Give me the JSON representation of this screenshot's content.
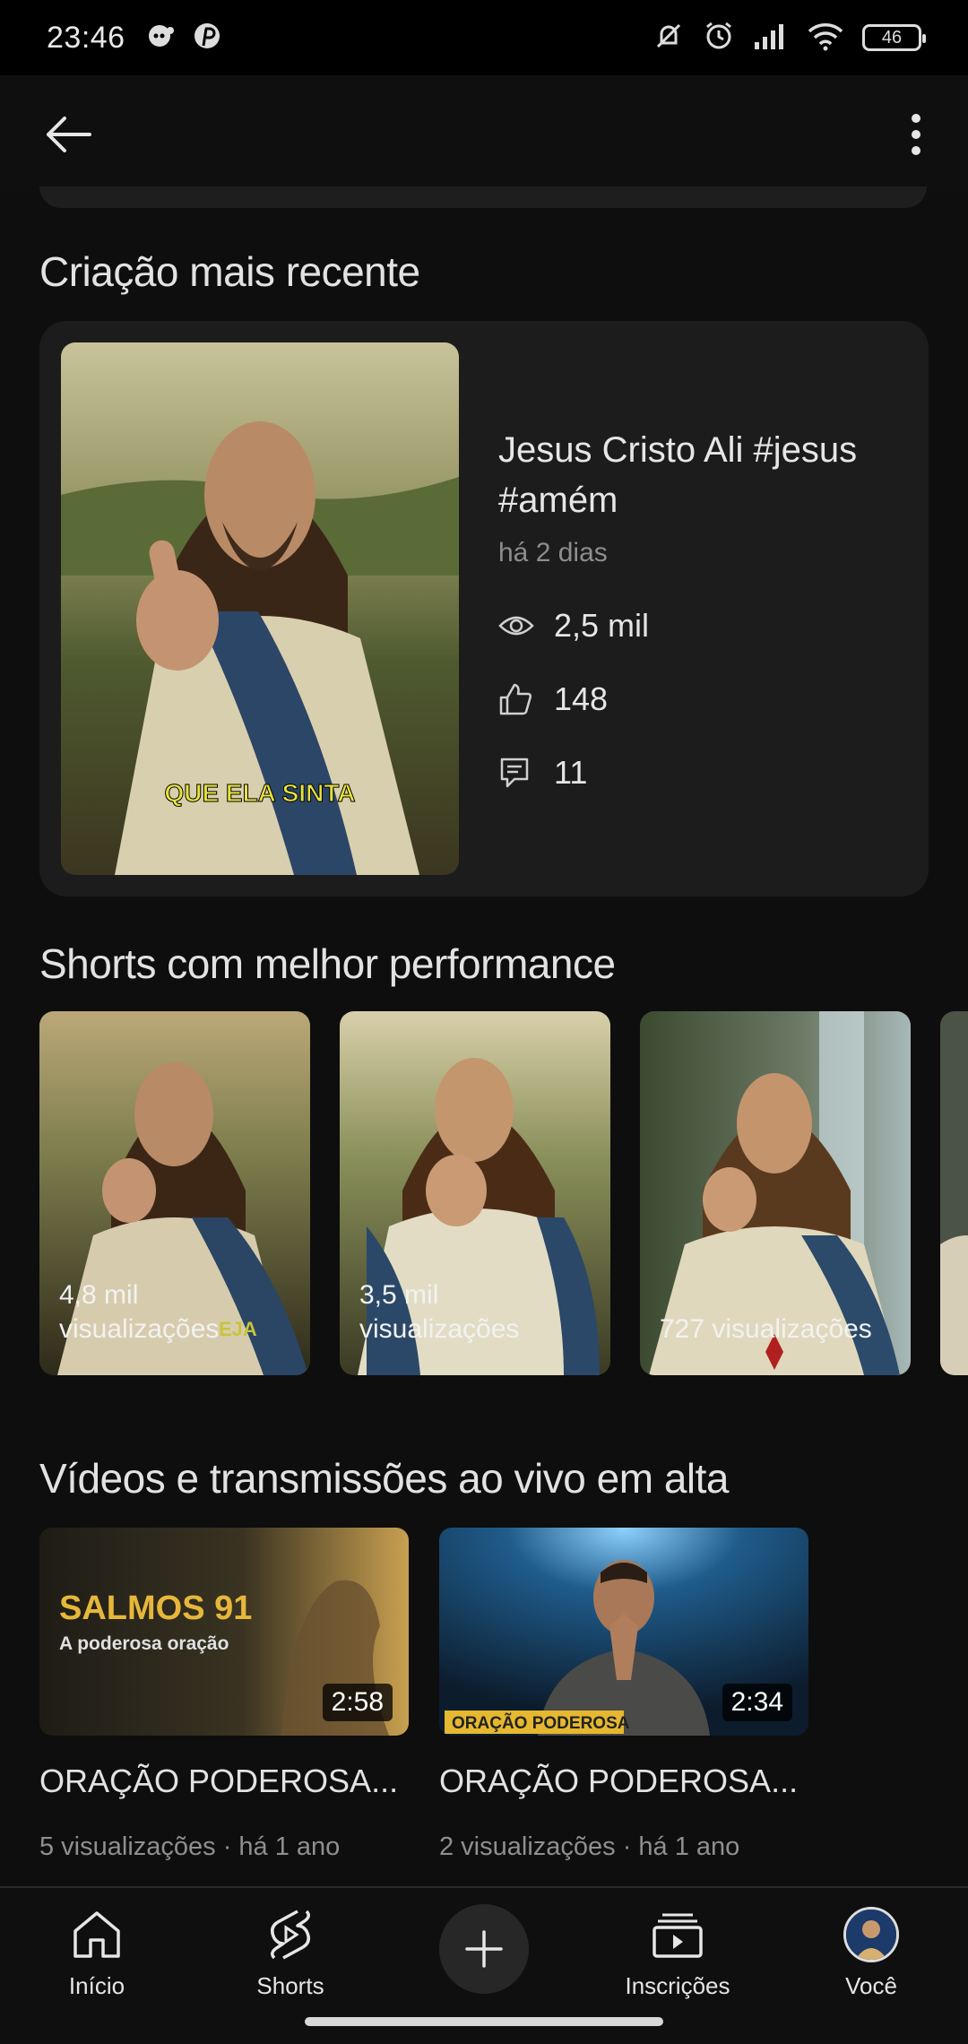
{
  "status_bar": {
    "time": "23:46",
    "battery": "46"
  },
  "recent": {
    "section_title": "Criação mais recente",
    "video_title": "Jesus Cristo Ali #jesus #amém",
    "date": "há 2 dias",
    "views": "2,5 mil",
    "likes": "148",
    "comments": "11",
    "thumb_caption": "QUE ELA SINTA"
  },
  "shorts": {
    "section_title": "Shorts com melhor performance",
    "items": [
      {
        "views": "4,8 mil visualizações",
        "caption": "EJA"
      },
      {
        "views": "3,5 mil visualizações"
      },
      {
        "views": "727 visualizações"
      }
    ]
  },
  "trending": {
    "section_title": "Vídeos e transmissões ao vivo em alta",
    "videos": [
      {
        "title": "ORAÇÃO PODEROSA...",
        "meta": "5 visualizações · há 1 ano",
        "duration": "2:58",
        "thumb_title": "SALMOS 91",
        "thumb_subtitle": "A poderosa oração"
      },
      {
        "title": "ORAÇÃO PODEROSA...",
        "meta": "2 visualizações · há 1 ano",
        "duration": "2:34",
        "thumb_banner": "ORAÇÃO PODEROSA"
      }
    ]
  },
  "nav": {
    "home": "Início",
    "shorts": "Shorts",
    "subscriptions": "Inscrições",
    "you": "Você"
  },
  "colors": {
    "background": "#0e0e0e",
    "card": "#1c1c1c",
    "muted_text": "#8d8d8d"
  }
}
